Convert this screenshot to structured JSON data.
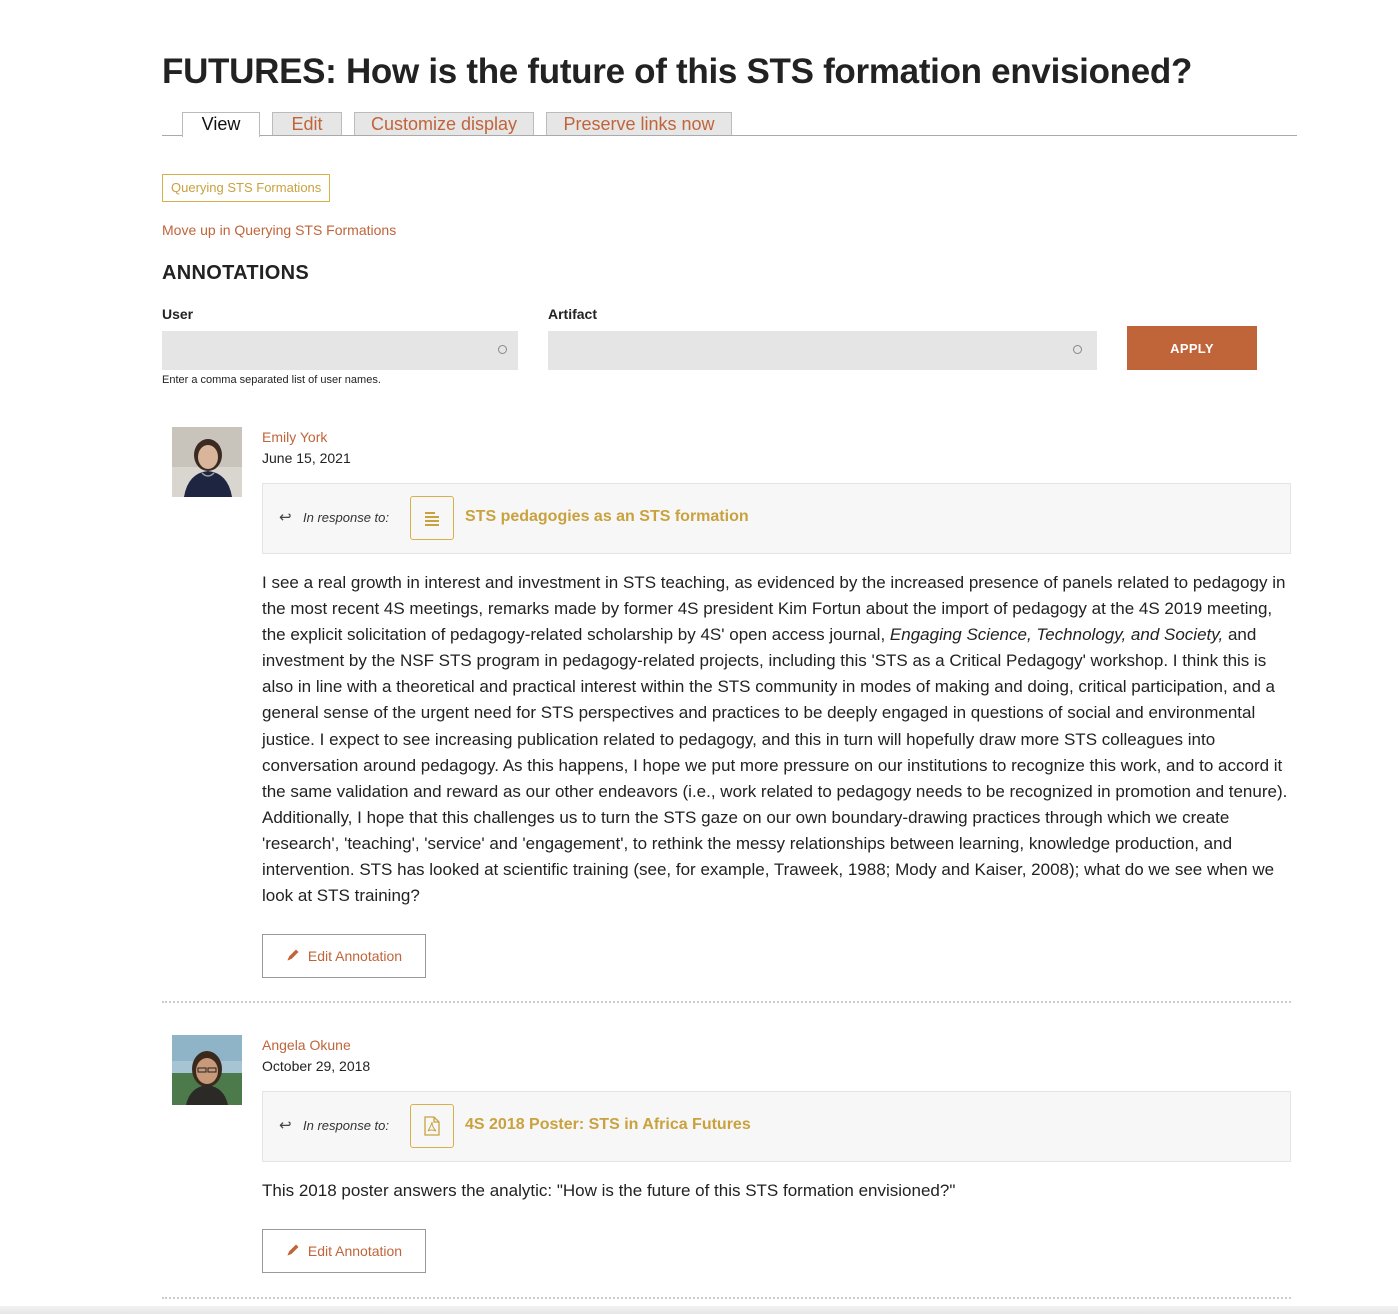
{
  "page": {
    "title": "FUTURES: How is the future of this STS formation envisioned?"
  },
  "tabs": [
    {
      "label": "View",
      "active": true
    },
    {
      "label": "Edit",
      "active": false
    },
    {
      "label": "Customize display",
      "active": false
    },
    {
      "label": "Preserve links now",
      "active": false
    }
  ],
  "tag": "Querying STS Formations",
  "move_up_link": "Move up in Querying STS Formations",
  "annotations": {
    "heading": "ANNOTATIONS",
    "filters": {
      "user_label": "User",
      "user_value": "",
      "user_help": "Enter a comma separated list of user names.",
      "artifact_label": "Artifact",
      "artifact_value": "",
      "apply_label": "APPLY"
    },
    "items": [
      {
        "author": "Emily York",
        "date": "June 15, 2021",
        "response_label": "In response to:",
        "response_title": "STS pedagogies as an STS formation",
        "response_icon": "text-document-icon",
        "text_part1": "I see a real growth in interest and investment in STS teaching, as evidenced by the increased presence of panels related to pedagogy in the most recent 4S meetings, remarks made by former 4S president Kim Fortun about the import of pedagogy at the 4S 2019 meeting, the explicit solicitation of pedagogy-related scholarship by 4S' open access journal,",
        "text_italic": "Engaging Science, Technology, and Society,",
        "text_part2": "and investment by the NSF STS program in pedagogy-related projects, including this 'STS as a Critical Pedagogy' workshop. I think this is also in line with a theoretical and practical interest within the STS community in modes of making and doing, critical participation, and a general sense of the urgent need for STS perspectives and practices to be deeply engaged in questions of social and environmental justice. I expect to see increasing publication related to pedagogy, and this in turn will hopefully draw more STS colleagues into conversation around pedagogy. As this happens, I hope we put more pressure on our institutions to recognize this work, and to accord it the same validation and reward as our other endeavors (i.e., work related to pedagogy needs to be recognized in promotion and tenure). Additionally, I hope that this  challenges us to turn the STS gaze on our own boundary-drawing practices through which we create 'research', 'teaching', 'service' and 'engagement', to rethink the messy relationships between learning, knowledge production, and intervention. STS has looked at scientific training (see, for example, Traweek, 1988; Mody and Kaiser, 2008); what do we see when we look at STS training?",
        "edit_label": "Edit Annotation"
      },
      {
        "author": "Angela Okune",
        "date": "October 29, 2018",
        "response_label": "In response to:",
        "response_title": "4S 2018 Poster: STS in Africa Futures",
        "response_icon": "pdf-document-icon",
        "text_part1": "This 2018 poster answers the analytic: \"How is the future of this STS formation envisioned?\"",
        "edit_label": "Edit Annotation"
      }
    ]
  },
  "colors": {
    "accent": "#c0643a",
    "gold": "#c9a23f",
    "panel": "#f7f7f7"
  }
}
